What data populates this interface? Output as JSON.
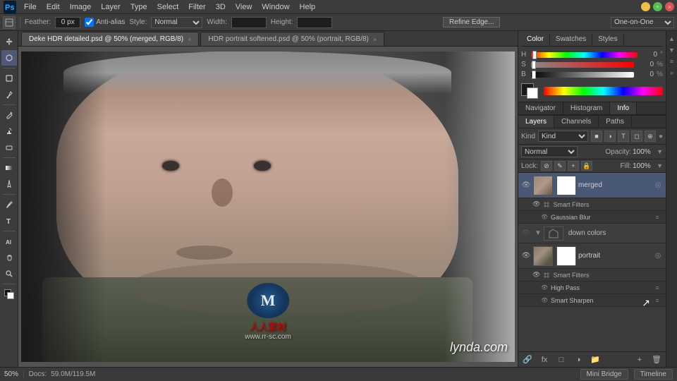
{
  "app": {
    "title": "Adobe Photoshop",
    "logo": "Ps"
  },
  "menubar": {
    "items": [
      "File",
      "Edit",
      "Image",
      "Layer",
      "Type",
      "Select",
      "Filter",
      "3D",
      "View",
      "Window",
      "Help"
    ]
  },
  "optionsbar": {
    "feather_label": "Feather:",
    "feather_value": "0 px",
    "antialias_label": "Anti-alias",
    "style_label": "Style:",
    "style_value": "Normal",
    "width_label": "Width:",
    "height_label": "Height:",
    "refine_edge_btn": "Refine Edge...",
    "mode_label": "One-on-One"
  },
  "tabs": [
    {
      "label": "Deke HDR detailed.psd @ 50% (merged, RGB/8)",
      "active": true
    },
    {
      "label": "HDR portrait softened.psd @ 50% (portrait, RGB/8)",
      "active": false
    }
  ],
  "color_panel": {
    "tabs": [
      "Color",
      "Swatches",
      "Styles"
    ],
    "active_tab": "Color",
    "sliders": [
      {
        "label": "H",
        "value": "0",
        "unit": "°"
      },
      {
        "label": "S",
        "value": "0",
        "unit": "%"
      },
      {
        "label": "B",
        "value": "0",
        "unit": "%"
      }
    ]
  },
  "info_panel": {
    "tabs": [
      "Navigator",
      "Histogram",
      "Info"
    ],
    "active_tab": "Info"
  },
  "layers_panel": {
    "tabs": [
      "Layers",
      "Channels",
      "Paths"
    ],
    "active_tab": "Layers",
    "filter_label": "Kind",
    "blend_mode": "Normal",
    "opacity_label": "Opacity:",
    "opacity_value": "100%",
    "lock_label": "Lock:",
    "fill_label": "Fill:",
    "fill_value": "100%",
    "layers": [
      {
        "id": "merged",
        "name": "merged",
        "type": "layer",
        "visible": true,
        "active": true,
        "smart_filters": true,
        "filters": [
          "Gaussian Blur"
        ]
      },
      {
        "id": "down-colors",
        "name": "down colors",
        "type": "group",
        "visible": false,
        "active": false
      },
      {
        "id": "portrait",
        "name": "portrait",
        "type": "layer",
        "visible": true,
        "active": false,
        "smart_filters": true,
        "filters": [
          "High Pass",
          "Smart Sharpen"
        ]
      }
    ]
  },
  "status_bar": {
    "zoom": "50%",
    "docs_label": "Docs:",
    "docs_value": "59.0M/119.5M",
    "mini_bridge": "Mini Bridge",
    "timeline": "Timeline"
  },
  "watermark": {
    "logo_text": "M",
    "line1": "人人素材",
    "line2": "www.rr-sc.com"
  },
  "lynda": {
    "text": "lynda.com"
  }
}
